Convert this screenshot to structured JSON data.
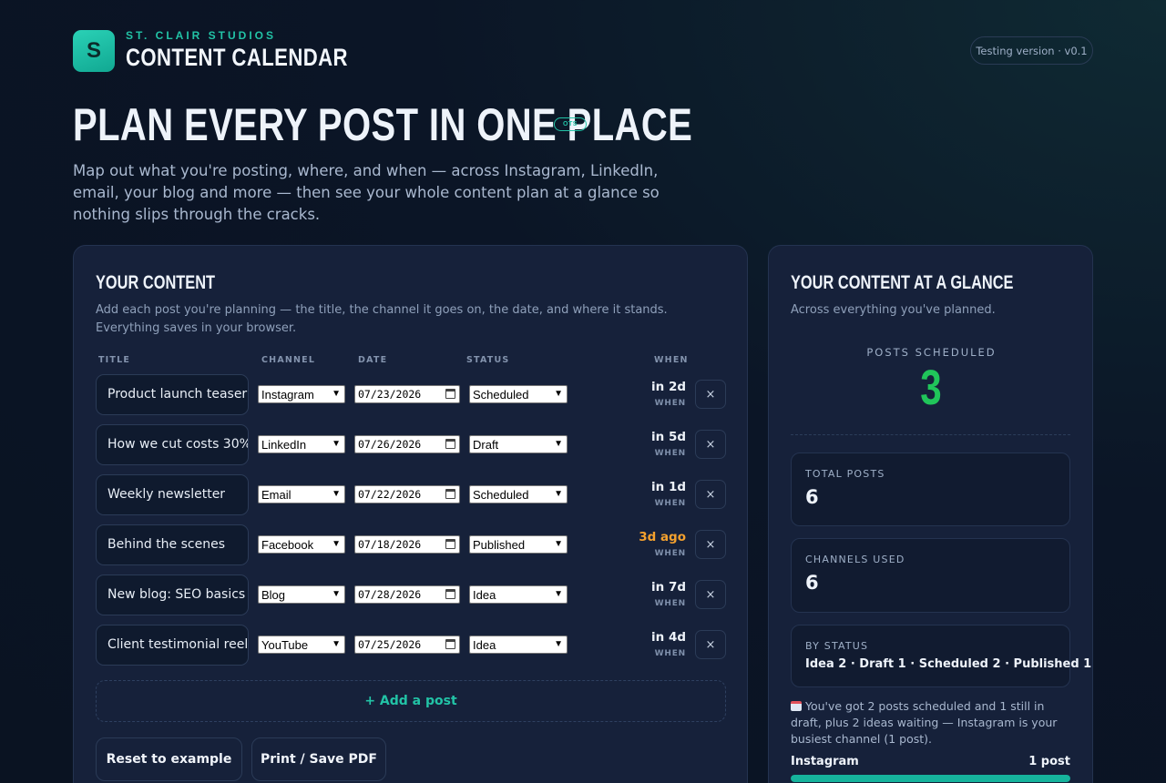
{
  "brand": {
    "studio": "ST. CLAIR STUDIOS",
    "logo_letter": "S",
    "app_title": "CONTENT CALENDAR"
  },
  "version_label": "Testing version · v0.1",
  "hero": {
    "title": "PLAN EVERY POST IN ONE PLACE",
    "badge": "OTS",
    "subtitle": "Map out what you're posting, where, and when — across Instagram, LinkedIn, email, your blog and more — then see your whole content plan at a glance so nothing slips through the cracks."
  },
  "content_panel": {
    "title": "YOUR CONTENT",
    "description": "Add each post you're planning — the title, the channel it goes on, the date, and where it stands. Everything saves in your browser.",
    "columns": {
      "title": "TITLE",
      "channel": "CHANNEL",
      "date": "DATE",
      "status": "STATUS",
      "when": "WHEN"
    },
    "rows": [
      {
        "title": "Product launch teaser",
        "channel": "Instagram",
        "date": "07/23/2026",
        "status": "Scheduled",
        "when": "in 2d",
        "when_label": "WHEN",
        "past": false
      },
      {
        "title": "How we cut costs 30%",
        "channel": "LinkedIn",
        "date": "07/26/2026",
        "status": "Draft",
        "when": "in 5d",
        "when_label": "WHEN",
        "past": false
      },
      {
        "title": "Weekly newsletter",
        "channel": "Email",
        "date": "07/22/2026",
        "status": "Scheduled",
        "when": "in 1d",
        "when_label": "WHEN",
        "past": false
      },
      {
        "title": "Behind the scenes",
        "channel": "Facebook",
        "date": "07/18/2026",
        "status": "Published",
        "when": "3d ago",
        "when_label": "WHEN",
        "past": true
      },
      {
        "title": "New blog: SEO basics",
        "channel": "Blog",
        "date": "07/28/2026",
        "status": "Idea",
        "when": "in 7d",
        "when_label": "WHEN",
        "past": false
      },
      {
        "title": "Client testimonial reel",
        "channel": "YouTube",
        "date": "07/25/2026",
        "status": "Idea",
        "when": "in 4d",
        "when_label": "WHEN",
        "past": false
      }
    ],
    "delete_glyph": "×",
    "add_label": "+ Add a post",
    "reset_label": "Reset to example",
    "print_label": "Print / Save PDF"
  },
  "glance_panel": {
    "title": "YOUR CONTENT AT A GLANCE",
    "description": "Across everything you've planned.",
    "scheduled_label": "POSTS SCHEDULED",
    "scheduled_value": "3",
    "total_label": "TOTAL POSTS",
    "total_value": "6",
    "channels_label": "CHANNELS USED",
    "channels_value": "6",
    "status_label": "BY STATUS",
    "status_value": "Idea 2 · Draft 1 · Scheduled 2 · Published 1",
    "insight": "You've got 2 posts scheduled and 1 still in draft, plus 2 ideas waiting — Instagram is your busiest channel (1 post).",
    "bar": {
      "name": "Instagram",
      "count": "1 post",
      "fraction": 1.0
    }
  },
  "colors": {
    "accent": "#22c3a6",
    "scheduled": "#20c55a",
    "past": "#f4a12e",
    "background": "#0b1526"
  }
}
